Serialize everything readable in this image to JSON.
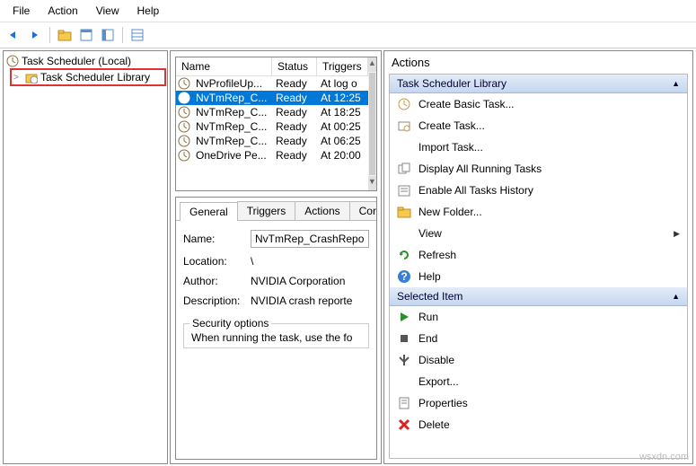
{
  "menu": {
    "items": [
      "File",
      "Action",
      "View",
      "Help"
    ]
  },
  "tree": {
    "root": "Task Scheduler (Local)",
    "child": "Task Scheduler Library",
    "expander": ">"
  },
  "list": {
    "headers": [
      "Name",
      "Status",
      "Triggers"
    ],
    "rows": [
      {
        "name": "NvProfileUp...",
        "status": "Ready",
        "trigger": "At log o"
      },
      {
        "name": "NvTmRep_C...",
        "status": "Ready",
        "trigger": "At 12:25"
      },
      {
        "name": "NvTmRep_C...",
        "status": "Ready",
        "trigger": "At 18:25"
      },
      {
        "name": "NvTmRep_C...",
        "status": "Ready",
        "trigger": "At 00:25"
      },
      {
        "name": "NvTmRep_C...",
        "status": "Ready",
        "trigger": "At 06:25"
      },
      {
        "name": "OneDrive Pe...",
        "status": "Ready",
        "trigger": "At 20:00"
      }
    ],
    "selected_index": 1
  },
  "details": {
    "tabs": [
      "General",
      "Triggers",
      "Actions",
      "Con"
    ],
    "active_tab": 0,
    "labels": {
      "name": "Name:",
      "location": "Location:",
      "author": "Author:",
      "description": "Description:"
    },
    "name": "NvTmRep_CrashRepo",
    "location": "\\",
    "author": "NVIDIA Corporation",
    "description": "NVIDIA crash reporte",
    "security_legend": "Security options",
    "security_text": "When running the task, use the fo"
  },
  "actions": {
    "title": "Actions",
    "lib_header": "Task Scheduler Library",
    "lib_items": [
      {
        "icon": "create-basic",
        "label": "Create Basic Task..."
      },
      {
        "icon": "create-task",
        "label": "Create Task..."
      },
      {
        "icon": "import",
        "label": "Import Task..."
      },
      {
        "icon": "running",
        "label": "Display All Running Tasks"
      },
      {
        "icon": "history",
        "label": "Enable All Tasks History"
      },
      {
        "icon": "folder",
        "label": "New Folder..."
      },
      {
        "icon": "none",
        "label": "View",
        "submenu": true
      },
      {
        "icon": "refresh",
        "label": "Refresh"
      },
      {
        "icon": "help",
        "label": "Help"
      }
    ],
    "sel_header": "Selected Item",
    "sel_items": [
      {
        "icon": "run",
        "label": "Run"
      },
      {
        "icon": "end",
        "label": "End"
      },
      {
        "icon": "disable",
        "label": "Disable"
      },
      {
        "icon": "none",
        "label": "Export..."
      },
      {
        "icon": "props",
        "label": "Properties"
      },
      {
        "icon": "delete",
        "label": "Delete"
      }
    ]
  },
  "watermark": "wsxdn.com"
}
